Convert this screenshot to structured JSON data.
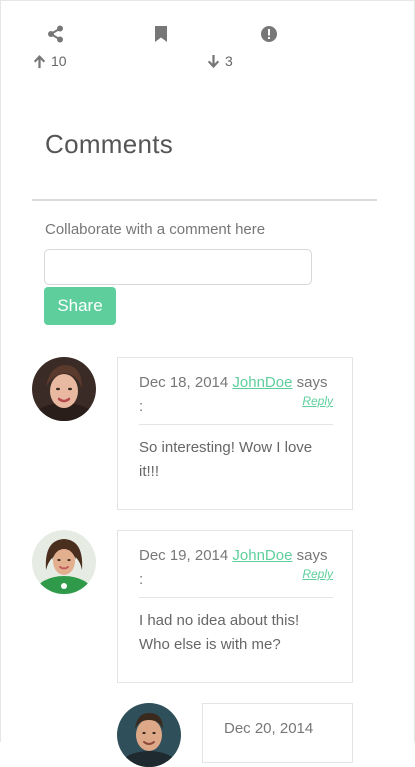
{
  "actions": {
    "share_icon": "share-icon",
    "bookmark_icon": "bookmark-icon",
    "report_icon": "exclamation-icon",
    "upvote_count": "10",
    "downvote_count": "3"
  },
  "comments_section": {
    "title": "Comments",
    "prompt": "Collaborate with a comment here",
    "input_value": "",
    "submit_label": "Share"
  },
  "comments": [
    {
      "date": "Dec 18, 2014",
      "author": "JohnDoe",
      "says": "says",
      "colon": ":",
      "reply_label": "Reply",
      "text": "So interesting! Wow I love it!!!"
    },
    {
      "date": "Dec 19, 2014",
      "author": "JohnDoe",
      "says": "says",
      "colon": ":",
      "reply_label": "Reply",
      "text": "I had no idea about this! Who else is with me?"
    },
    {
      "date": "Dec 20, 2014"
    }
  ],
  "colors": {
    "accent": "#5ecf9c",
    "text": "#666666",
    "border": "#e4e4e4"
  }
}
